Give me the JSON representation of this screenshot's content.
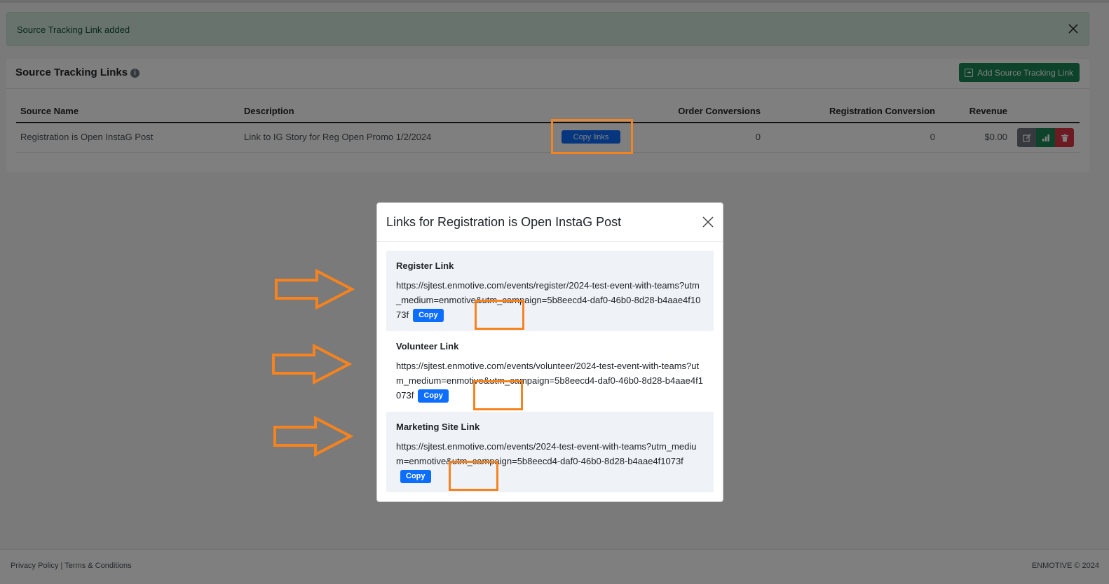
{
  "alert": {
    "message": "Source Tracking Link added"
  },
  "card": {
    "title": "Source Tracking Links",
    "add_button_label": "Add Source Tracking Link"
  },
  "table": {
    "headers": [
      "Source Name",
      "Description",
      "Order Conversions",
      "Registration Conversion",
      "Revenue"
    ],
    "rows": [
      {
        "source_name": "Registration is Open InstaG Post",
        "description": "Link to IG Story for Reg Open Promo 1/2/2024",
        "copy_links_label": "Copy links",
        "order_conversions": "0",
        "registration_conversion": "0",
        "revenue": "$0.00"
      }
    ]
  },
  "modal": {
    "title": "Links for Registration is Open InstaG Post",
    "links": [
      {
        "label": "Register Link",
        "url": "https://sjtest.enmotive.com/events/register/2024-test-event-with-teams?utm_medium=enmotive&utm_campaign=5b8eecd4-daf0-46b0-8d28-b4aae4f1073f",
        "copy_label": "Copy"
      },
      {
        "label": "Volunteer Link",
        "url": "https://sjtest.enmotive.com/events/volunteer/2024-test-event-with-teams?utm_medium=enmotive&utm_campaign=5b8eecd4-daf0-46b0-8d28-b4aae4f1073f",
        "copy_label": "Copy"
      },
      {
        "label": "Marketing Site Link",
        "url": "https://sjtest.enmotive.com/events/2024-test-event-with-teams?utm_medium=enmotive&utm_campaign=5b8eecd4-daf0-46b0-8d28-b4aae4f1073f",
        "copy_label": "Copy"
      }
    ]
  },
  "footer": {
    "privacy": "Privacy Policy",
    "separator": "|",
    "terms": "Terms & Conditions",
    "copyright": "ENMOTIVE © 2024"
  },
  "icons": {
    "alert_close": "close-icon",
    "info": "info-icon",
    "add": "plus-square-icon",
    "edit": "edit-icon",
    "stats": "bar-chart-icon",
    "delete": "trash-icon",
    "modal_close": "close-icon",
    "annotation": "arrow-right-icon"
  },
  "colors": {
    "primary": "#0d6efd",
    "success": "#198754",
    "danger": "#dc3545",
    "secondary": "#6c757d",
    "annotation": "#f7831e",
    "alert_bg": "#d1e7dd"
  }
}
